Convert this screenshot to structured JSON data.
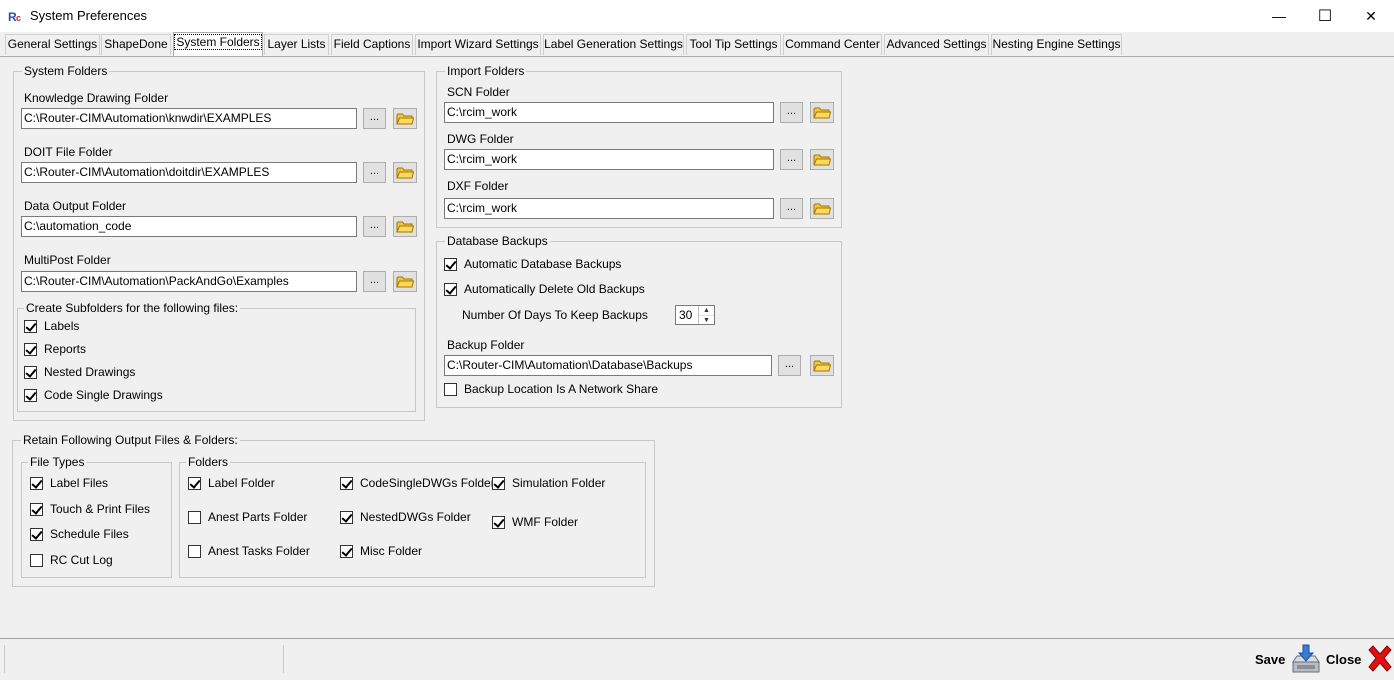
{
  "window": {
    "title": "System Preferences",
    "minimize_glyph": "—",
    "maximize_glyph": "☐",
    "close_glyph": "✕"
  },
  "tabs": [
    {
      "label": "General Settings"
    },
    {
      "label": "ShapeDone"
    },
    {
      "label": "System Folders"
    },
    {
      "label": "Layer Lists"
    },
    {
      "label": "Field Captions"
    },
    {
      "label": "Import Wizard Settings"
    },
    {
      "label": "Label Generation Settings"
    },
    {
      "label": "Tool Tip Settings"
    },
    {
      "label": "Command Center"
    },
    {
      "label": "Advanced Settings"
    },
    {
      "label": "Nesting Engine Settings"
    }
  ],
  "system_folders": {
    "title": "System Folders",
    "ellipsis": "...",
    "knowledge": {
      "label": "Knowledge Drawing Folder",
      "value": "C:\\Router-CIM\\Automation\\knwdir\\EXAMPLES"
    },
    "doit": {
      "label": "DOIT File Folder",
      "value": "C:\\Router-CIM\\Automation\\doitdir\\EXAMPLES"
    },
    "data_output": {
      "label": "Data Output Folder",
      "value": "C:\\automation_code"
    },
    "multipost": {
      "label": "MultiPost Folder",
      "value": "C:\\Router-CIM\\Automation\\PackAndGo\\Examples"
    },
    "subfolders": {
      "title": "Create Subfolders for the following files:",
      "items": [
        {
          "label": "Labels",
          "checked": true
        },
        {
          "label": "Reports",
          "checked": true
        },
        {
          "label": "Nested Drawings",
          "checked": true
        },
        {
          "label": "Code Single Drawings",
          "checked": true
        }
      ]
    }
  },
  "import_folders": {
    "title": "Import Folders",
    "scn": {
      "label": "SCN Folder",
      "value": "C:\\rcim_work"
    },
    "dwg": {
      "label": "DWG Folder",
      "value": "C:\\rcim_work"
    },
    "dxf": {
      "label": "DXF Folder",
      "value": "C:\\rcim_work"
    }
  },
  "database_backups": {
    "title": "Database Backups",
    "auto_backup": {
      "label": "Automatic Database Backups",
      "checked": true
    },
    "auto_delete": {
      "label": "Automatically Delete Old Backups",
      "checked": true
    },
    "days_label": "Number Of Days To Keep Backups",
    "days_value": "30",
    "backup_folder": {
      "label": "Backup Folder",
      "value": "C:\\Router-CIM\\Automation\\Database\\Backups"
    },
    "network_share": {
      "label": "Backup Location Is A Network Share",
      "checked": false
    }
  },
  "retain": {
    "title": "Retain Following Output Files & Folders:",
    "file_types": {
      "title": "File Types",
      "items": [
        {
          "label": "Label Files",
          "checked": true
        },
        {
          "label": "Touch & Print Files",
          "checked": true
        },
        {
          "label": "Schedule Files",
          "checked": true
        },
        {
          "label": "RC Cut Log",
          "checked": false
        }
      ]
    },
    "folders": {
      "title": "Folders",
      "items": [
        {
          "label": "Label Folder",
          "checked": true
        },
        {
          "label": "Anest Parts Folder",
          "checked": false
        },
        {
          "label": "Anest Tasks Folder",
          "checked": false
        },
        {
          "label": "CodeSingleDWGs Folder",
          "checked": true
        },
        {
          "label": "NestedDWGs Folder",
          "checked": true
        },
        {
          "label": "Misc Folder",
          "checked": true
        },
        {
          "label": "Simulation Folder",
          "checked": true
        },
        {
          "label": "WMF Folder",
          "checked": true
        }
      ]
    }
  },
  "footer": {
    "save_label": "Save",
    "close_label": "Close"
  },
  "colors": {
    "folder_icon": "#e8b400",
    "close_x": "#e01010",
    "active_tab_bg": "#ffffff",
    "window_bg": "#f0f0f0"
  }
}
